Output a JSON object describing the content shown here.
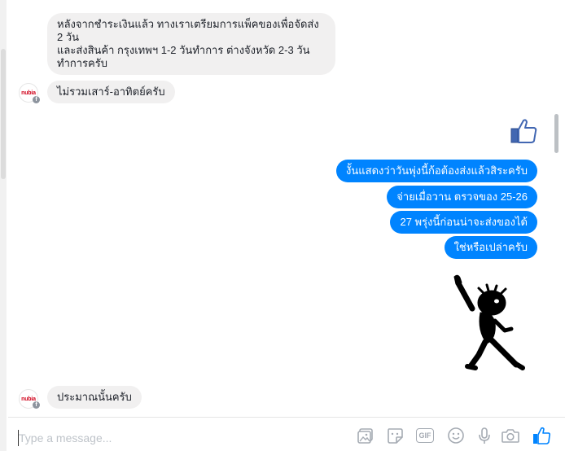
{
  "conversation": {
    "incoming": [
      {
        "text": "หลังจากชำระเงินแล้ว  ทางเราเตรียมการแพ็คของเพื่อจัดส่ง 2 วัน\nและส่งสินค้า กรุงเทพฯ 1-2 วันทำการ ต่างจังหวัด 2-3 วันทำการครับ"
      },
      {
        "text": "ไม่รวมเสาร์-อาทิตย์ครับ"
      },
      {
        "text": "ประมาณนั้นครับ"
      }
    ],
    "outgoing": [
      {
        "text": "งั้นแสดงว่าวันพุ่งนี้ก้อต้องส่งแล้วสิระครับ"
      },
      {
        "text": "จ่ายเมื่อวาน ตรวจของ 25-26"
      },
      {
        "text": "27 พรุ่งนี้ก่อนน่าจะส่งของได้"
      },
      {
        "text": "ใช่หรือเปล่าครับ"
      }
    ],
    "contact": {
      "avatar_text": "nubia",
      "badge_icon": "facebook-icon"
    },
    "sent_like_icon": "thumbs-up-icon",
    "sticker": "dancing-stick-figure-sticker"
  },
  "composer": {
    "placeholder": "Type a message...",
    "tools": [
      "photo-icon",
      "sticker-icon",
      "gif-icon",
      "emoji-icon",
      "microphone-icon",
      "camera-icon",
      "thumbs-up-icon"
    ],
    "gif_label": "GIF"
  },
  "colors": {
    "outgoing_bubble": "#0084ff",
    "incoming_bubble": "#f1f0f0",
    "icon_gray": "#a5abb3"
  }
}
